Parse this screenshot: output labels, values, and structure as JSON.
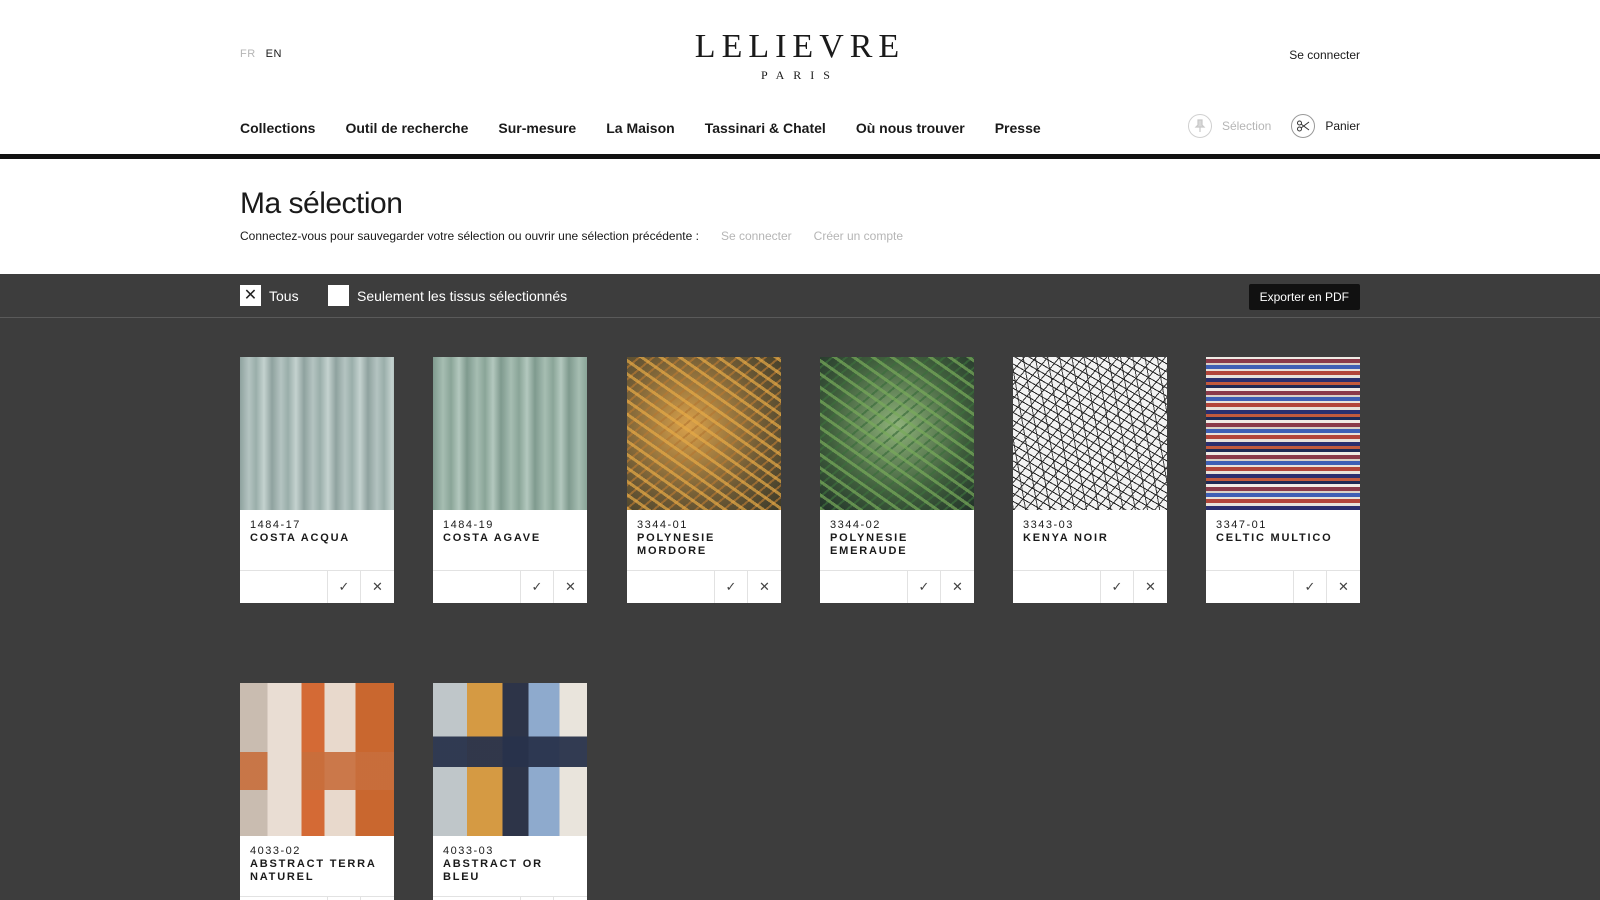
{
  "header": {
    "lang_fr": "FR",
    "lang_en": "EN",
    "brand": "LELIEVRE",
    "city": "PARIS",
    "login": "Se connecter"
  },
  "nav": {
    "collections": "Collections",
    "search_tool": "Outil de recherche",
    "custom": "Sur-mesure",
    "maison": "La Maison",
    "tassinari": "Tassinari & Chatel",
    "find_us": "Où nous trouver",
    "press": "Presse"
  },
  "shop": {
    "selection": "Sélection",
    "cart": "Panier"
  },
  "page": {
    "title": "Ma sélection",
    "subtitle": "Connectez-vous pour sauvegarder votre sélection ou ouvrir une sélection précédente :",
    "login_link": "Se connecter",
    "create_account_link": "Créer un compte"
  },
  "filters": {
    "all_label": "Tous",
    "all_checked": true,
    "only_selected_label": "Seulement les tissus sélectionnés",
    "only_selected_checked": false,
    "export_label": "Exporter en PDF"
  },
  "products": [
    {
      "ref": "1484-17",
      "name": "COSTA ACQUA"
    },
    {
      "ref": "1484-19",
      "name": "COSTA AGAVE"
    },
    {
      "ref": "3344-01",
      "name": "POLYNESIE MORDORE"
    },
    {
      "ref": "3344-02",
      "name": "POLYNESIE EMERAUDE"
    },
    {
      "ref": "3343-03",
      "name": "KENYA NOIR"
    },
    {
      "ref": "3347-01",
      "name": "CELTIC MULTICO"
    },
    {
      "ref": "4033-02",
      "name": "ABSTRACT TERRA NATUREL"
    },
    {
      "ref": "4033-03",
      "name": "ABSTRACT OR BLEU"
    }
  ],
  "icons": {
    "check": "✓",
    "close": "✕",
    "checkbox_checked": "✕"
  }
}
